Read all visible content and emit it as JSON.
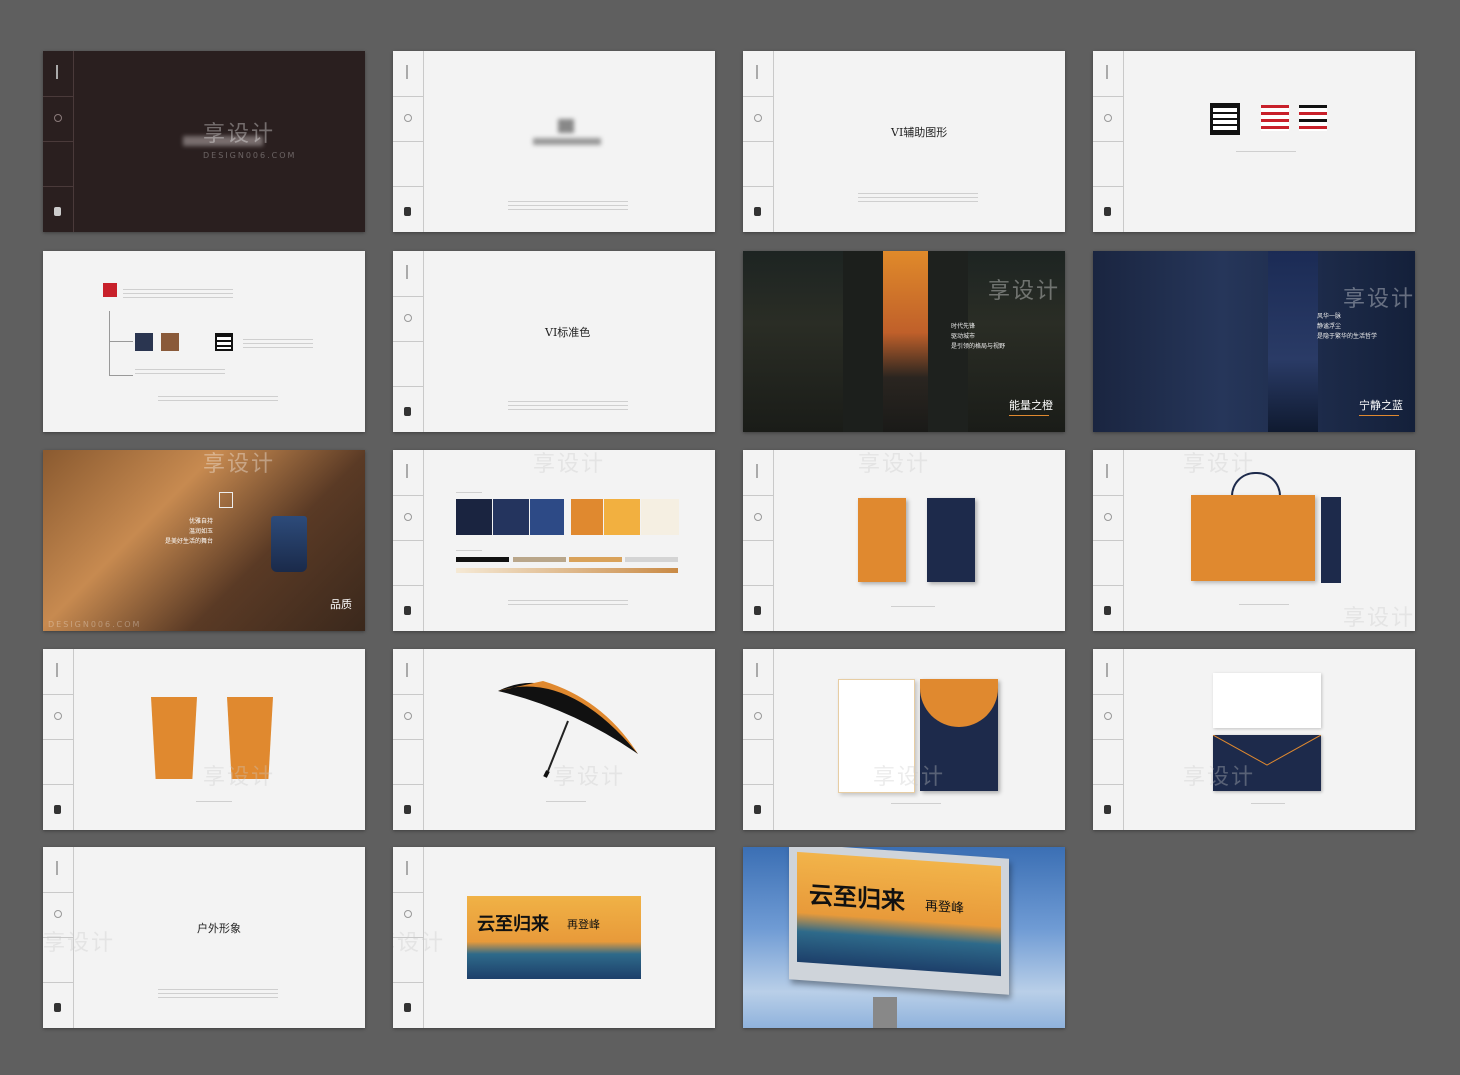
{
  "watermark": {
    "main": "享设计",
    "sub": "DESIGN006.COM"
  },
  "slides": {
    "vi_graphic": {
      "title": "VI辅助图形"
    },
    "vi_color": {
      "title": "VI标准色"
    },
    "orange": {
      "title": "能量之橙",
      "lines": [
        "时代先锋",
        "驱动城市",
        "是引领的格局与视野"
      ]
    },
    "blue": {
      "title": "宁静之蓝",
      "lines": [
        "风华一脉",
        "静谧浮尘",
        "是隐于繁华的生活哲学"
      ]
    },
    "quality": {
      "title": "品质",
      "lines": [
        "优雅自持",
        "温润如玉",
        "是美好生活的舞台"
      ]
    },
    "outdoor": {
      "title": "户外形象"
    },
    "billboard": {
      "headline": "云至归来",
      "tagline": "再登峰"
    }
  },
  "colors": {
    "orange": "#e0892f",
    "navy": "#1d2a4b",
    "dark": "#2a1f1f",
    "bg": "#5f5f5f"
  }
}
